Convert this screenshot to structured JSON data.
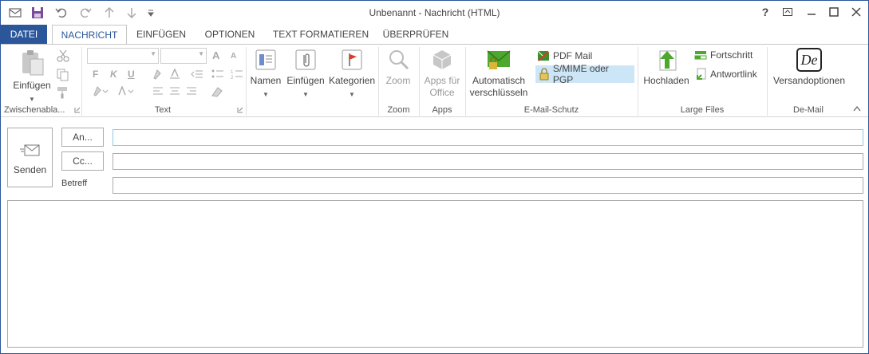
{
  "window": {
    "title": "Unbenannt - Nachricht (HTML)",
    "help_label": "?",
    "restore_label": "❐",
    "minimize_label": "—",
    "maximize_label": "☐",
    "close_label": "✕"
  },
  "quick_access": {
    "outlook_icon": "outlook-icon",
    "save_icon": "save-icon",
    "undo_icon": "undo-icon",
    "redo_icon": "redo-icon",
    "up_icon": "up-arrow-icon",
    "down_icon": "down-arrow-icon",
    "customize_icon": "customize-icon"
  },
  "tabs": [
    "DATEI",
    "NACHRICHT",
    "EINFÜGEN",
    "OPTIONEN",
    "TEXT FORMATIEREN",
    "ÜBERPRÜFEN"
  ],
  "ribbon": {
    "clipboard": {
      "paste_label": "Einfügen",
      "group_label": "Zwischenabla..."
    },
    "text": {
      "group_label": "Text",
      "grow_label": "A",
      "shrink_label": "A",
      "bold": "F",
      "italic": "K",
      "underline": "U"
    },
    "names": {
      "label": "Namen"
    },
    "include": {
      "label": "Einfügen"
    },
    "categories": {
      "label": "Kategorien"
    },
    "zoom": {
      "label": "Zoom",
      "group_label": "Zoom"
    },
    "apps": {
      "label_line1": "Apps für",
      "label_line2": "Office",
      "group_label": "Apps"
    },
    "email_protection": {
      "auto_encrypt_line1": "Automatisch",
      "auto_encrypt_line2": "verschlüsseln",
      "pdf_mail": "PDF Mail",
      "smime_pgp": "S/MIME oder PGP",
      "group_label": "E-Mail-Schutz"
    },
    "large_files": {
      "upload_label": "Hochladen",
      "progress_label": "Fortschritt",
      "reply_link_label": "Antwortlink",
      "group_label": "Large Files"
    },
    "demail": {
      "shipping_options_label": "Versandoptionen",
      "logo_text": "De",
      "group_label": "De-Mail"
    }
  },
  "compose": {
    "send_label": "Senden",
    "to_label": "An...",
    "cc_label": "Cc...",
    "subject_label": "Betreff",
    "to_value": "",
    "cc_value": "",
    "subject_value": "",
    "body_value": ""
  },
  "colors": {
    "accent": "#2b579a",
    "selected_highlight": "#cde6f7",
    "ok_green": "#4ea72e"
  }
}
